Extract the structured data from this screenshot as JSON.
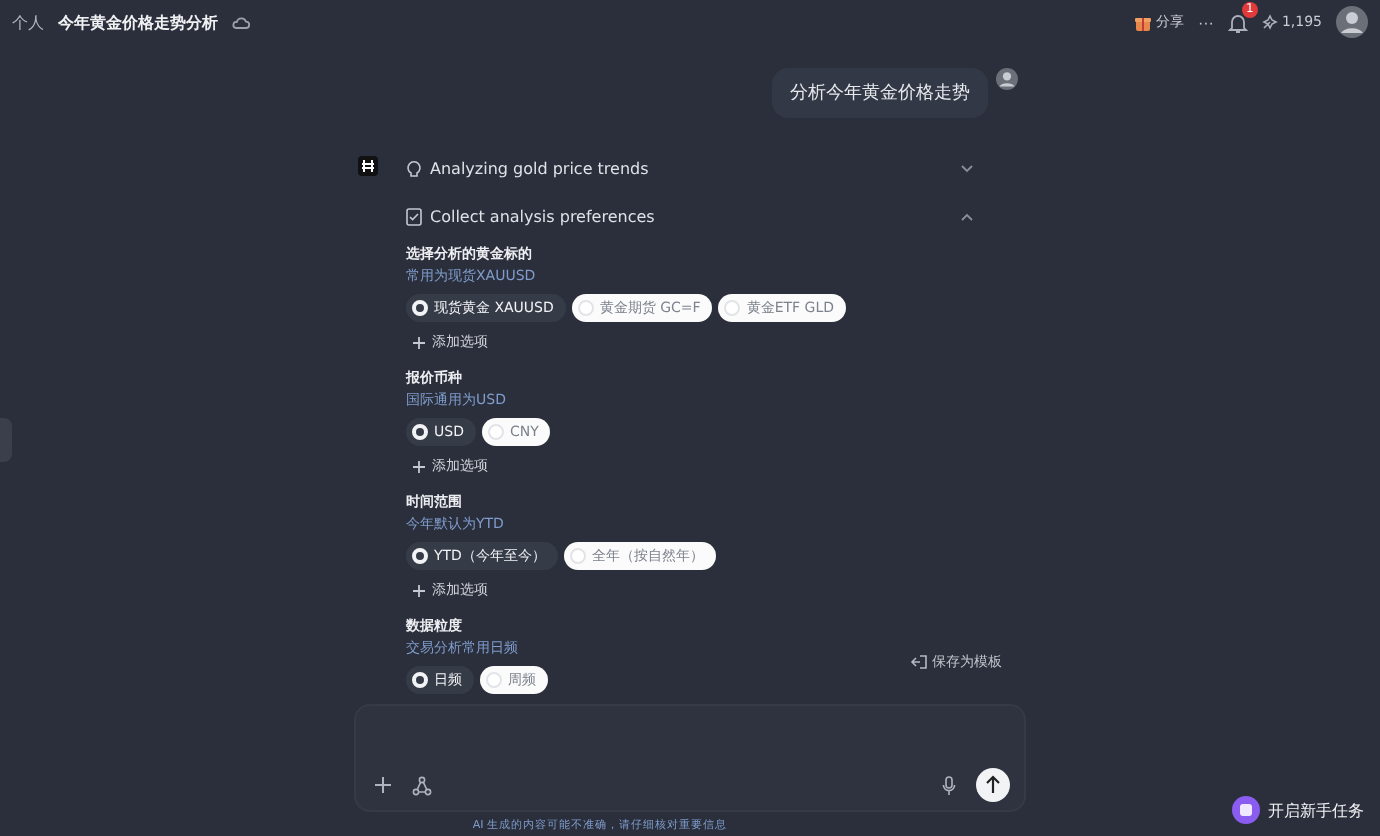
{
  "breadcrumb": {
    "parent": "个人",
    "title": "今年黄金价格走势分析"
  },
  "header_actions": {
    "share": "分享",
    "more": "···",
    "notifications": "1",
    "points": "1,195"
  },
  "user_message": "分析今年黄金价格走势",
  "steps": [
    {
      "label": "Analyzing gold price trends",
      "kind": "thinking",
      "expanded": false
    },
    {
      "label": "Collect analysis preferences",
      "kind": "form",
      "expanded": true
    }
  ],
  "questions": [
    {
      "title": "选择分析的黄金标的",
      "hint": "常用为现货XAUUSD",
      "options": [
        {
          "label": "现货黄金 XAUUSD",
          "selected": true
        },
        {
          "label": "黄金期货 GC=F",
          "selected": false
        },
        {
          "label": "黄金ETF GLD",
          "selected": false
        }
      ],
      "add_option": "添加选项"
    },
    {
      "title": "报价币种",
      "hint": "国际通用为USD",
      "options": [
        {
          "label": "USD",
          "selected": true
        },
        {
          "label": "CNY",
          "selected": false
        }
      ],
      "add_option": "添加选项"
    },
    {
      "title": "时间范围",
      "hint": "今年默认为YTD",
      "options": [
        {
          "label": "YTD（今年至今）",
          "selected": true
        },
        {
          "label": "全年（按自然年）",
          "selected": false
        }
      ],
      "add_option": "添加选项"
    },
    {
      "title": "数据粒度",
      "hint": "交易分析常用日频",
      "options": [
        {
          "label": "日频",
          "selected": true
        },
        {
          "label": "周频",
          "selected": false
        }
      ]
    }
  ],
  "save_template": "保存为模板",
  "disclaimer": "AI 生成的内容可能不准确，请仔细核对重要信息",
  "task_button": "开启新手任务"
}
